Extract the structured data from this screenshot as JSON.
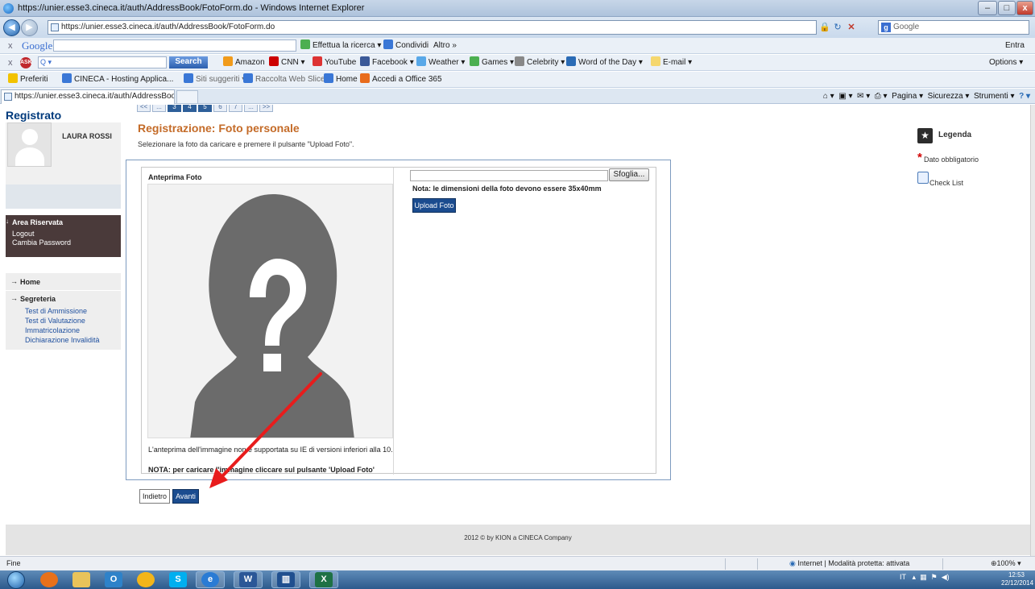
{
  "window": {
    "title": "https://unier.esse3.cineca.it/auth/AddressBook/FotoForm.do - Windows Internet Explorer",
    "controls": {
      "minimize": "–",
      "maximize": "□",
      "close": "x"
    }
  },
  "address_bar": {
    "url": "https://unier.esse3.cineca.it/auth/AddressBook/FotoForm.do",
    "search_placeholder": "Google"
  },
  "google_toolbar": {
    "logo": "Google",
    "close": "x",
    "search_label": "Effettua la ricerca ▾",
    "share_label": "Condividi",
    "more_label": "Altro »",
    "signin_label": "Entra"
  },
  "ask_toolbar": {
    "close": "x",
    "search_input": "Q ▾",
    "search_button": "Search",
    "links": [
      "Amazon",
      "CNN ▾",
      "YouTube",
      "Facebook ▾",
      "Weather ▾",
      "Games ▾",
      "Celebrity ▾",
      "Word of the Day ▾",
      "E-mail ▾"
    ],
    "options_label": "Options ▾"
  },
  "favorites_bar": {
    "favorites_label": "Preferiti",
    "items": [
      "CINECA - Hosting Applica...",
      "Siti suggeriti ▾",
      "Raccolta Web Slice ▾",
      "Home",
      "Accedi a Office 365"
    ]
  },
  "tabs": {
    "active_title": "https://unier.esse3.cineca.it/auth/AddressBook/F...",
    "command_bar": [
      "Pagina ▾",
      "Sicurezza ▾",
      "Strumenti ▾"
    ]
  },
  "pager": [
    "<<",
    "...",
    "3",
    "4",
    "5",
    "6",
    "7",
    "...",
    ">>"
  ],
  "site": {
    "section_title": "Registrato"
  },
  "user": {
    "name": "LAURA ROSSI"
  },
  "reserved_area": {
    "header": "Area Riservata",
    "links": [
      "Logout",
      "Cambia Password"
    ]
  },
  "nav": {
    "home": "Home",
    "secretariat": "Segreteria",
    "links": [
      "Test di Ammissione",
      "Test di Valutazione",
      "Immatricolazione",
      "Dichiarazione Invalidità"
    ]
  },
  "main": {
    "title": "Registrazione: Foto personale",
    "instructions": "Selezionare la foto da caricare e premere il pulsante \"Upload Foto\".",
    "preview_label": "Anteprima Foto",
    "preview_note": "L'anteprima dell'immagine non è supportata su IE di versioni inferiori alla 10.",
    "upload_note": "NOTA: per caricare l'immagine cliccare sul pulsante 'Upload Foto'",
    "file_value": "",
    "browse_button": "Sfoglia...",
    "size_note": "Nota: le dimensioni della foto devono essere 35x40mm",
    "upload_button": "Upload Foto",
    "back_button": "Indietro",
    "next_button": "Avanti"
  },
  "legend": {
    "title": "Legenda",
    "required_label": "Dato obbligatorio",
    "checklist_label": "Check List"
  },
  "footer": {
    "text": "2012 © by KION a CINECA Company"
  },
  "status_bar": {
    "status": "Fine",
    "zone": "Internet | Modalità protetta: attivata",
    "zoom": "100% ▾"
  },
  "taskbar": {
    "tray_lang": "IT",
    "time": "12:53",
    "date": "22/12/2014"
  },
  "colors": {
    "accent_orange": "#c46b28",
    "primary_blue": "#1b4c8f",
    "annotation_red": "#e81c1c"
  }
}
